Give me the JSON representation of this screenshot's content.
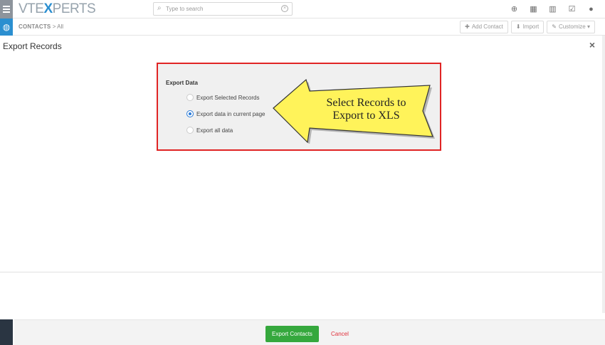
{
  "app": {
    "logo_left": "VTE",
    "logo_mid": "X",
    "logo_right": "PERTS"
  },
  "search": {
    "placeholder": "Type to search"
  },
  "top_icons": [
    "add-icon",
    "calendar-icon",
    "reports-icon",
    "tasks-icon",
    "user-icon"
  ],
  "breadcrumb": {
    "module": "CONTACTS",
    "separator": ">",
    "view": "All"
  },
  "actions": {
    "add_contact": "Add Contact",
    "import": "Import",
    "customize": "Customize"
  },
  "page": {
    "title": "Export Records",
    "close": "×"
  },
  "export_data": {
    "heading": "Export Data",
    "options": [
      {
        "label": "Export Selected Records",
        "checked": false
      },
      {
        "label": "Export data in current page",
        "checked": true
      },
      {
        "label": "Export all data",
        "checked": false
      }
    ]
  },
  "callout": {
    "line1": "Select Records to",
    "line2": "Export to XLS"
  },
  "footer": {
    "export_button": "Export Contacts",
    "cancel": "Cancel"
  },
  "colors": {
    "accent": "#2b8fd0",
    "primary_button": "#35a83d",
    "highlight_border": "#e02424",
    "callout_fill": "#fff35a"
  }
}
